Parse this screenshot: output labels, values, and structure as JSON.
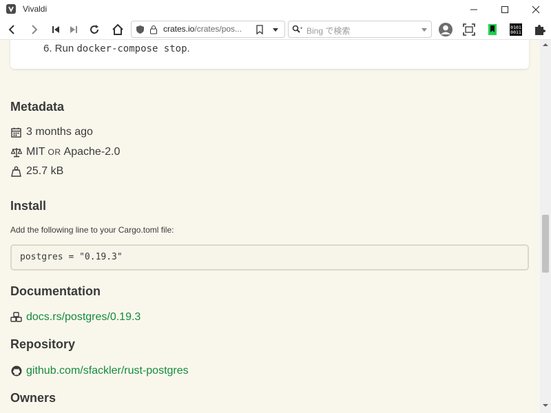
{
  "window": {
    "title": "Vivaldi"
  },
  "toolbar": {
    "url_host": "crates.io",
    "url_path": "/crates/pos...",
    "search_placeholder": "Bing で検索"
  },
  "content": {
    "step": {
      "number": "6. Run ",
      "code": "docker-compose stop",
      "suffix": "."
    },
    "metadata": {
      "heading": "Metadata",
      "updated": "3 months ago",
      "license_a": "MIT",
      "license_or": "OR",
      "license_b": "Apache-2.0",
      "size": "25.7 kB"
    },
    "install": {
      "heading": "Install",
      "note": "Add the following line to your Cargo.toml file:",
      "code": "postgres = \"0.19.3\""
    },
    "documentation": {
      "heading": "Documentation",
      "link": "docs.rs/postgres/0.19.3"
    },
    "repository": {
      "heading": "Repository",
      "link": "github.com/sfackler/rust-postgres"
    },
    "owners": {
      "heading": "Owners"
    }
  },
  "colors": {
    "link": "#158a3c",
    "page_bg": "#f9f7ec",
    "heading": "#3a3a3a"
  }
}
